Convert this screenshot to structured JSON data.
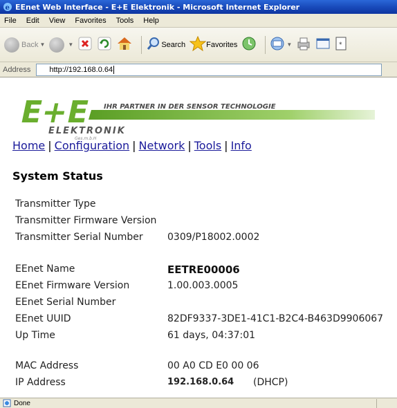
{
  "window": {
    "title": "EEnet Web Interface - E+E Elektronik - Microsoft Internet Explorer"
  },
  "menu": {
    "file": "File",
    "edit": "Edit",
    "view": "View",
    "favorites": "Favorites",
    "tools": "Tools",
    "help": "Help"
  },
  "toolbar": {
    "back": "Back",
    "search": "Search",
    "favorites": "Favorites"
  },
  "address": {
    "label": "Address",
    "url": "http://192.168.0.64"
  },
  "logo": {
    "mark": "E+E",
    "slogan": "IHR PARTNER IN DER SENSOR TECHNOLOGIE",
    "company": "ELEKTRONIK",
    "suffix": "Ges.m.b.H"
  },
  "nav": {
    "home": "Home",
    "configuration": "Configuration",
    "network": "Network",
    "tools": "Tools",
    "info": "Info",
    "separator": "|"
  },
  "page": {
    "title": "System Status"
  },
  "status": {
    "transmitter_type": {
      "label": "Transmitter Type",
      "value": ""
    },
    "transmitter_fw": {
      "label": "Transmitter Firmware Version",
      "value": ""
    },
    "transmitter_serial": {
      "label": "Transmitter Serial Number",
      "value": "0309/P18002.0002"
    },
    "eenet_name": {
      "label": "EEnet Name",
      "value": "EETRE00006"
    },
    "eenet_fw": {
      "label": "EEnet Firmware Version",
      "value": "1.00.003.0005"
    },
    "eenet_serial": {
      "label": "EEnet Serial Number",
      "value": ""
    },
    "eenet_uuid": {
      "label": "EEnet UUID",
      "value": "82DF9337-3DE1-41C1-B2C4-B463D9906067"
    },
    "uptime": {
      "label": "Up Time",
      "value": "61 days, 04:37:01"
    },
    "mac": {
      "label": "MAC Address",
      "value": "00 A0 CD E0 00 06"
    },
    "ip": {
      "label": "IP Address",
      "value": "192.168.0.64",
      "mode": "(DHCP)"
    }
  },
  "statusbar": {
    "text": "Done"
  },
  "colors": {
    "logo_green": "#6aae2e",
    "link_blue": "#1a1a9a",
    "titlebar_blue": "#1848b8"
  }
}
